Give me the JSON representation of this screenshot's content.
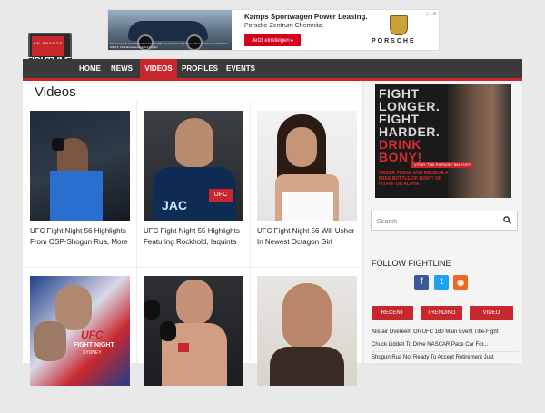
{
  "ad_top": {
    "fineprint": "911 Carrera S: Kraftstoffverbrauch (in l/100 km) innerorts 13,8-13,2; außerorts 7,3-6,7; kombiniert 9,8-9,4; CO2-Emissionen 230-217 g/km",
    "title": "Kamps Sportwagen Power Leasing.",
    "subtitle": "Porsche Zentrum Chemnitz.",
    "button": "Jetzt einsteigen ▸",
    "brand": "PORSCHE",
    "close": "▷ ✕"
  },
  "logo": {
    "top_text": "BN SPORTS",
    "word": "FIGHTLINE"
  },
  "nav": {
    "items": [
      "HOME",
      "NEWS",
      "VIDEOS",
      "PROFILES",
      "EVENTS"
    ],
    "active": "VIDEOS"
  },
  "main": {
    "title": "Videos",
    "videos": [
      {
        "title": "UFC Fight Night 56 Highlights From OSP-Shogun Rua, More"
      },
      {
        "title": "UFC Fight Night 55 Highlights Featuring Rockhold, Iaquinta"
      },
      {
        "title": "UFC Fight Night 56 Will Usher In Newest Octagon Girl"
      },
      {
        "title": ""
      },
      {
        "title": ""
      },
      {
        "title": ""
      }
    ],
    "thumb_texts": {
      "jacket_text": "JAC",
      "badge": "UFC",
      "event_ufc": "UFC",
      "event_name": "FIGHT NIGHT",
      "event_city": "SYDNEY"
    }
  },
  "side": {
    "ad": {
      "lines": [
        "FIGHT",
        "LONGER.",
        "FIGHT",
        "HARDER.",
        "DRINK",
        "BONY!"
      ],
      "nameplate": "VITOR \"THE PHENOM\" BELFORT",
      "order": "ORDER TODAY AND RECEIVE A FREE BOTTLE OF BONY! OR NITRO! OR ALPHA"
    },
    "search_placeholder": "Search",
    "follow": "FOLLOW FIGHTLINE",
    "social": [
      {
        "name": "facebook",
        "glyph": "f",
        "color": "#3b5998"
      },
      {
        "name": "twitter",
        "glyph": "t",
        "color": "#1da1f2"
      },
      {
        "name": "rss",
        "glyph": "◉",
        "color": "#f26522"
      }
    ],
    "tabs": [
      "RECENT",
      "TRENDING",
      "VIDEO"
    ],
    "recent": [
      "Alistair Overeem On UFC 180 Main Event Title-Fight",
      "Chuck Liddell To Drive NASCAR Pace Car For...",
      "Shogun Rua Not Ready To Accept Retirement Just"
    ]
  }
}
